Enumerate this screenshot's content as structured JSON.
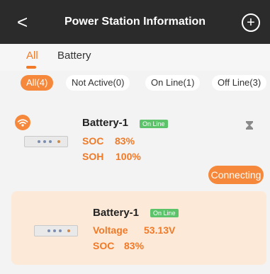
{
  "header": {
    "back": "<",
    "title": "Power Station Information",
    "plus": "+"
  },
  "tabs": [
    {
      "label": "All",
      "active": true
    },
    {
      "label": "Battery",
      "active": false
    }
  ],
  "filters": [
    {
      "label": "All(4)",
      "active": true
    },
    {
      "label": "Not Active(0)",
      "active": false
    },
    {
      "label": "On Line(1)",
      "active": false
    },
    {
      "label": "Off Line(3)",
      "active": false
    }
  ],
  "card1": {
    "name": "Battery-1",
    "status": "On Line",
    "soc_label": "SOC",
    "soc_value": "83%",
    "soh_label": "SOH",
    "soh_value": "100%",
    "button": "Connecting"
  },
  "card2": {
    "name": "Battery-1",
    "status": "On Line",
    "voltage_label": "Voltage",
    "voltage_value": "53.13V",
    "soc_label": "SOC",
    "soc_value": "83%"
  },
  "colors": {
    "accent": "#f5883a",
    "online": "#5cc36a",
    "header": "#2b2b2b"
  }
}
